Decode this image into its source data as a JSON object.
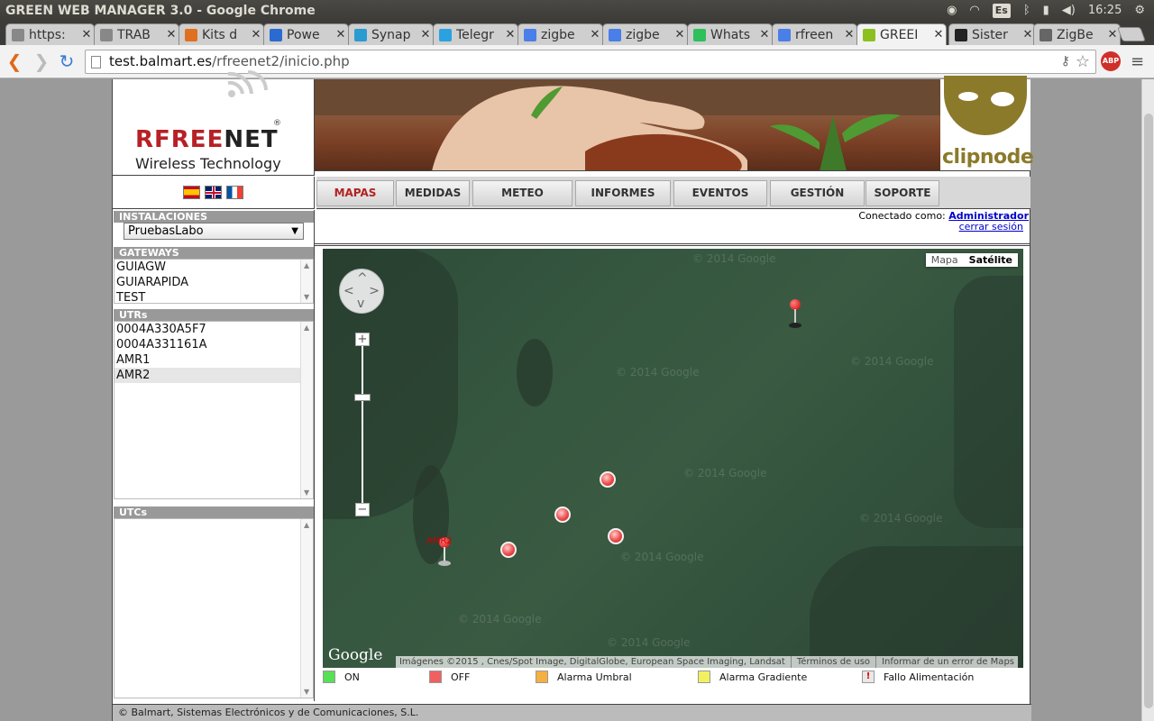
{
  "window": {
    "title": "GREEN WEB MANAGER 3.0 - Google Chrome",
    "clock": "16:25",
    "kb_layout": "Es"
  },
  "tabs": [
    {
      "label": "https:",
      "color": "#888888"
    },
    {
      "label": "TRAB",
      "color": "#888888"
    },
    {
      "label": "Kits d",
      "color": "#e07020"
    },
    {
      "label": "Powe",
      "color": "#2a6bd1"
    },
    {
      "label": "Synap",
      "color": "#2a9bd1"
    },
    {
      "label": "Telegr",
      "color": "#2aa1e0"
    },
    {
      "label": "zigbe",
      "color": "#4a7ee8"
    },
    {
      "label": "zigbe",
      "color": "#4a7ee8"
    },
    {
      "label": "Whats",
      "color": "#2ec05a"
    },
    {
      "label": "rfreen",
      "color": "#4a7ee8"
    },
    {
      "label": "GREEI",
      "color": "#8cc020"
    },
    {
      "label": "Sister",
      "color": "#222222"
    },
    {
      "label": "ZigBe",
      "color": "#666666"
    }
  ],
  "address": {
    "host": "test.balmart.es",
    "path": "/rfreenet2/inicio.php"
  },
  "extensions": {
    "abp": "ABP"
  },
  "logo": {
    "brand_red": "RFREE",
    "brand_dark": "NET",
    "reg": "®",
    "tagline": "Wireless Technology"
  },
  "clipnode": {
    "word": "clipnode"
  },
  "nav": [
    "MAPAS",
    "MEDIDAS",
    "METEO",
    "INFORMES",
    "EVENTOS",
    "GESTIÓN",
    "SOPORTE"
  ],
  "session": {
    "prefix": "Conectado como:",
    "user": "Administrador",
    "logout": "cerrar sesión"
  },
  "sidebar": {
    "installations_header": "INSTALACIONES",
    "installation_selected": "PruebasLabo",
    "gateways_header": "GATEWAYS",
    "gateways": [
      "GUIAGW",
      "GUIARAPIDA",
      "TEST"
    ],
    "utrs_header": "UTRs",
    "utrs": [
      "0004A330A5F7",
      "0004A331161A",
      "AMR1",
      "AMR2"
    ],
    "utcs_header": "UTCs"
  },
  "map": {
    "type_options": [
      "Mapa",
      "Satélite"
    ],
    "selected_type": "Satélite",
    "google_logo": "Google",
    "attribution": [
      "Imágenes ©2015 , Cnes/Spot Image, DigitalGlobe, European Space Imaging, Landsat",
      "Términos de uso",
      "Informar de un error de Maps"
    ],
    "watermark": "© 2014 Google",
    "marker_label": "AMR2"
  },
  "legend": [
    {
      "label": "ON",
      "color": "#55e055"
    },
    {
      "label": "OFF",
      "color": "#f06060"
    },
    {
      "label": "Alarma Umbral",
      "color": "#f5b040"
    },
    {
      "label": "Alarma Gradiente",
      "color": "#f0f060"
    },
    {
      "label": "Fallo Alimentación",
      "color": "#e8e8e8",
      "glyph": "!"
    }
  ],
  "footer": "© Balmart, Sistemas Electrónicos y de Comunicaciones, S.L."
}
